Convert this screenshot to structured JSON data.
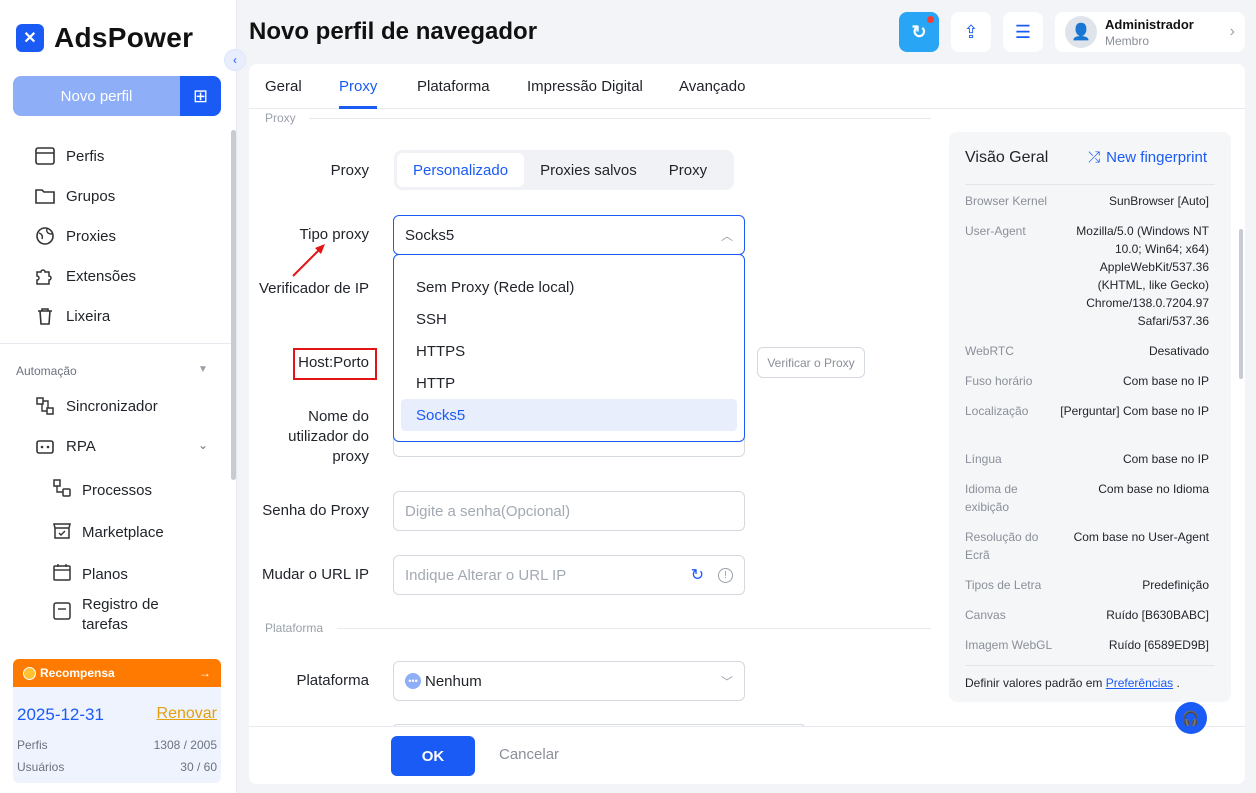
{
  "app": {
    "name": "AdsPower"
  },
  "sidebar": {
    "new_profile": "Novo perfil",
    "items": [
      {
        "label": "Perfis",
        "icon": "window-icon"
      },
      {
        "label": "Grupos",
        "icon": "folder-icon"
      },
      {
        "label": "Proxies",
        "icon": "globe-icon"
      },
      {
        "label": "Extensões",
        "icon": "puzzle-icon"
      },
      {
        "label": "Lixeira",
        "icon": "trash-icon"
      }
    ],
    "section_automation": "Automação",
    "automation_items": [
      {
        "label": "Sincronizador",
        "icon": "sync-icon"
      },
      {
        "label": "RPA",
        "icon": "robot-icon"
      }
    ],
    "rpa_sub": [
      {
        "label": "Processos",
        "icon": "process-icon"
      },
      {
        "label": "Marketplace",
        "icon": "store-icon"
      },
      {
        "label": "Planos",
        "icon": "calendar-icon"
      },
      {
        "label": "Registro de tarefas",
        "icon": "log-icon"
      }
    ],
    "reward": {
      "label": "Recompensa",
      "date": "2025-12-31",
      "renew": "Renovar",
      "profiles_label": "Perfis",
      "profiles_value": "1308 / 2005",
      "users_label": "Usuários",
      "users_value": "30 / 60"
    }
  },
  "header": {
    "title": "Novo perfil de navegador",
    "user_name": "Administrador",
    "user_role": "Membro"
  },
  "tabs": [
    {
      "label": "Geral"
    },
    {
      "label": "Proxy"
    },
    {
      "label": "Plataforma"
    },
    {
      "label": "Impressão Digital"
    },
    {
      "label": "Avançado"
    }
  ],
  "form": {
    "section_proxy": "Proxy",
    "proxy_label": "Proxy",
    "proxy_options": [
      "Personalizado",
      "Proxies salvos",
      "Proxy"
    ],
    "tipo_label": "Tipo proxy",
    "tipo_value": "Socks5",
    "verificador_label": "Verificador de IP",
    "host_label": "Host:Porto",
    "verify_button": "Verificar o Proxy",
    "user_label": "Nome do utilizador do proxy",
    "senha_label": "Senha do Proxy",
    "senha_placeholder": "Digite a senha(Opcional)",
    "url_label": "Mudar o URL IP",
    "url_placeholder": "Indique Alterar o URL IP",
    "section_platform": "Plataforma",
    "platform_label": "Plataforma",
    "platform_value": "Nenhum",
    "dropdown": [
      "Sem Proxy (Rede local)",
      "SSH",
      "HTTPS",
      "HTTP",
      "Socks5"
    ],
    "ok": "OK",
    "cancel": "Cancelar"
  },
  "overview": {
    "title": "Visão Geral",
    "new_fingerprint": "New fingerprint",
    "rows": [
      {
        "k": "Browser Kernel",
        "v": "SunBrowser [Auto]"
      },
      {
        "k": "User-Agent",
        "v": "Mozilla/5.0 (Windows NT 10.0; Win64; x64) AppleWebKit/537.36 (KHTML, like Gecko) Chrome/138.0.7204.97 Safari/537.36"
      },
      {
        "k": "WebRTC",
        "v": "Desativado"
      },
      {
        "k": "Fuso horário",
        "v": "Com base no IP"
      },
      {
        "k": "Localização",
        "v": "[Perguntar] Com base no IP"
      },
      {
        "k": "Língua",
        "v": "Com base no IP"
      },
      {
        "k": "Idioma de exibição",
        "v": "Com base no Idioma"
      },
      {
        "k": "Resolução do Ecrã",
        "v": "Com base no User-Agent"
      },
      {
        "k": "Tipos de Letra",
        "v": "Predefinição"
      },
      {
        "k": "Canvas",
        "v": "Ruído [B630BABC]"
      },
      {
        "k": "Imagem WebGL",
        "v": "Ruído [6589ED9B]"
      }
    ],
    "footer_text": "Definir valores padrão em",
    "footer_link": "Preferências",
    "footer_end": "."
  }
}
